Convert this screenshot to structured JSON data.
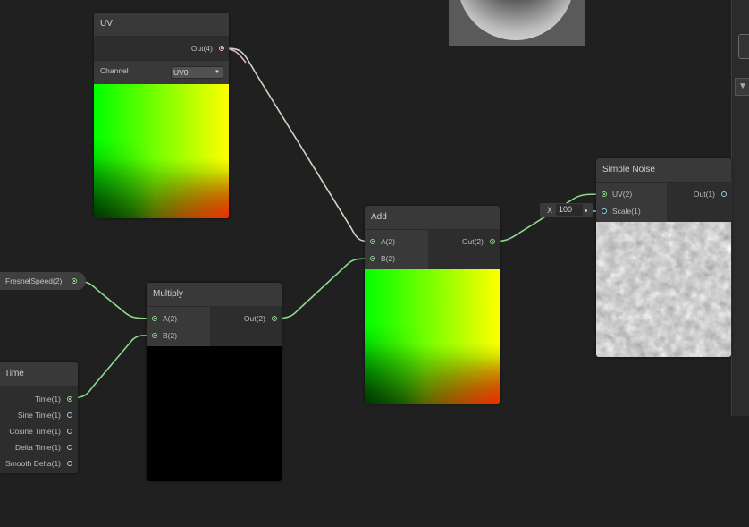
{
  "nodes": {
    "uv": {
      "title": "UV",
      "output": "Out(4)",
      "channel_label": "Channel",
      "channel_value": "UV0"
    },
    "add": {
      "title": "Add",
      "input_a": "A(2)",
      "input_b": "B(2)",
      "output": "Out(2)"
    },
    "multiply": {
      "title": "Multiply",
      "input_a": "A(2)",
      "input_b": "B(2)",
      "output": "Out(2)"
    },
    "time": {
      "title": "Time",
      "outputs": [
        "Time(1)",
        "Sine Time(1)",
        "Cosine Time(1)",
        "Delta Time(1)",
        "Smooth Delta(1)"
      ]
    },
    "simple_noise": {
      "title": "Simple Noise",
      "input_uv": "UV(2)",
      "input_scale": "Scale(1)",
      "output": "Out(1)",
      "scale_field_label": "X",
      "scale_field_value": "100"
    },
    "property": {
      "label": "FresnelSpeed(2)"
    }
  },
  "colors": {
    "wire_green": "#8fd88f",
    "wire_pink": "#e6b4d2",
    "canvas": "#202020",
    "node_bg": "#393939"
  }
}
